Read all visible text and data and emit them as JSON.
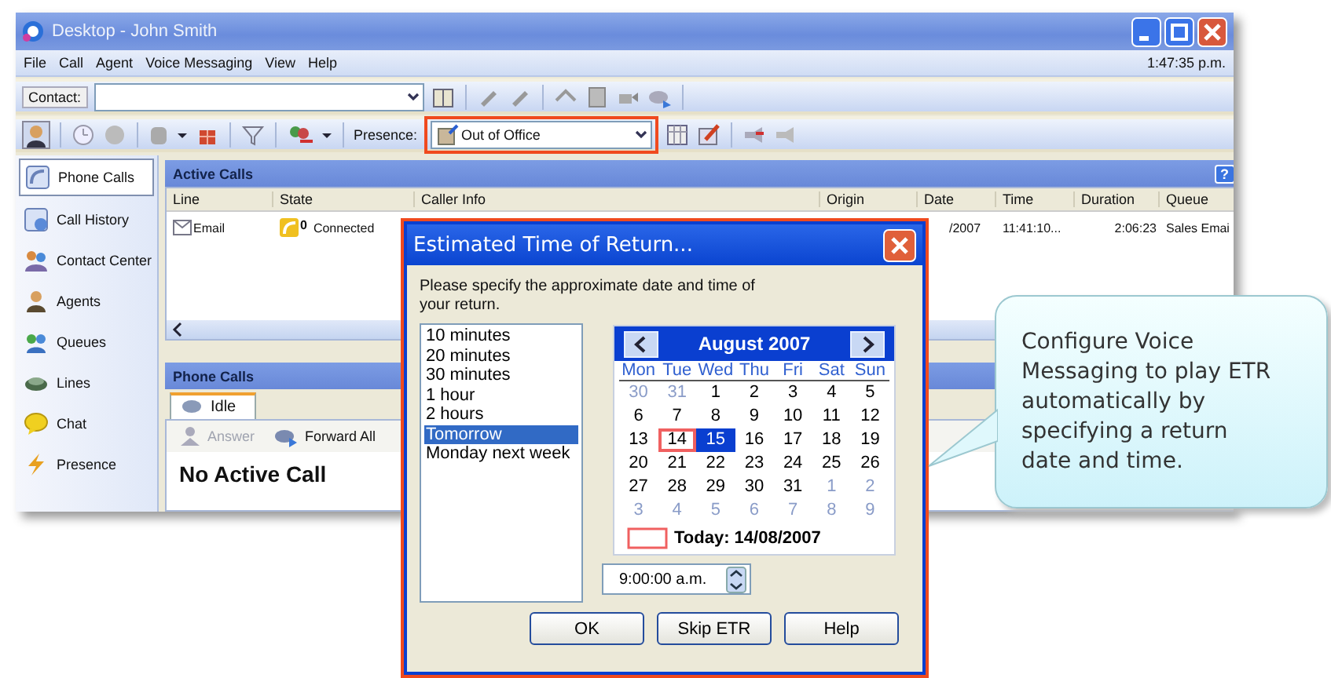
{
  "window": {
    "title": "Desktop - John Smith"
  },
  "menu": [
    {
      "label": "File"
    },
    {
      "label": "Call"
    },
    {
      "label": "Agent"
    },
    {
      "label": "Voice Messaging"
    },
    {
      "label": "View"
    },
    {
      "label": "Help"
    }
  ],
  "clock": "1:47:35 p.m.",
  "contact": {
    "label": "Contact:"
  },
  "presence": {
    "label": "Presence:",
    "value": "Out of Office"
  },
  "sidebar": {
    "items": [
      {
        "label": "Phone Calls",
        "selected": true
      },
      {
        "label": "Call History",
        "selected": false
      },
      {
        "label": "Contact Center",
        "selected": false
      },
      {
        "label": "Agents",
        "selected": false
      },
      {
        "label": "Queues",
        "selected": false
      },
      {
        "label": "Lines",
        "selected": false
      },
      {
        "label": "Chat",
        "selected": false
      },
      {
        "label": "Presence",
        "selected": false
      }
    ]
  },
  "active_calls": {
    "title": "Active Calls",
    "help": "?",
    "columns": [
      "Line",
      "State",
      "Caller Info",
      "Origin",
      "Date",
      "Time",
      "Duration",
      "Queue"
    ],
    "rows": [
      {
        "line": "Email",
        "state_count": "0",
        "state": "Connected",
        "date": "/2007",
        "time": "11:41:10...",
        "duration": "2:06:23",
        "queue": "Sales Emai"
      }
    ]
  },
  "phone_calls": {
    "title": "Phone Calls",
    "tab": "Idle",
    "actions": [
      {
        "label": "Answer",
        "disabled": true
      },
      {
        "label": "Forward All",
        "disabled": false
      }
    ],
    "status": "No Active Call"
  },
  "dialog": {
    "title": "Estimated Time of Return...",
    "prompt": "Please specify the approximate date and time of your return.",
    "options": [
      {
        "label": "10 minutes",
        "selected": false
      },
      {
        "label": "20 minutes",
        "selected": false
      },
      {
        "label": "30 minutes",
        "selected": false
      },
      {
        "label": "1 hour",
        "selected": false
      },
      {
        "label": "2 hours",
        "selected": false
      },
      {
        "label": "Tomorrow",
        "selected": true
      },
      {
        "label": "Monday next week",
        "selected": false
      }
    ],
    "calendar": {
      "month": "August 2007",
      "weekdays": [
        "Mon",
        "Tue",
        "Wed",
        "Thu",
        "Fri",
        "Sat",
        "Sun"
      ],
      "days": [
        {
          "text": "30",
          "in_month": false,
          "today": false,
          "selected": false
        },
        {
          "text": "31",
          "in_month": false,
          "today": false,
          "selected": false
        },
        {
          "text": "1",
          "in_month": true,
          "today": false,
          "selected": false
        },
        {
          "text": "2",
          "in_month": true,
          "today": false,
          "selected": false
        },
        {
          "text": "3",
          "in_month": true,
          "today": false,
          "selected": false
        },
        {
          "text": "4",
          "in_month": true,
          "today": false,
          "selected": false
        },
        {
          "text": "5",
          "in_month": true,
          "today": false,
          "selected": false
        },
        {
          "text": "6",
          "in_month": true,
          "today": false,
          "selected": false
        },
        {
          "text": "7",
          "in_month": true,
          "today": false,
          "selected": false
        },
        {
          "text": "8",
          "in_month": true,
          "today": false,
          "selected": false
        },
        {
          "text": "9",
          "in_month": true,
          "today": false,
          "selected": false
        },
        {
          "text": "10",
          "in_month": true,
          "today": false,
          "selected": false
        },
        {
          "text": "11",
          "in_month": true,
          "today": false,
          "selected": false
        },
        {
          "text": "12",
          "in_month": true,
          "today": false,
          "selected": false
        },
        {
          "text": "13",
          "in_month": true,
          "today": false,
          "selected": false
        },
        {
          "text": "14",
          "in_month": true,
          "today": true,
          "selected": false
        },
        {
          "text": "15",
          "in_month": true,
          "today": false,
          "selected": true
        },
        {
          "text": "16",
          "in_month": true,
          "today": false,
          "selected": false
        },
        {
          "text": "17",
          "in_month": true,
          "today": false,
          "selected": false
        },
        {
          "text": "18",
          "in_month": true,
          "today": false,
          "selected": false
        },
        {
          "text": "19",
          "in_month": true,
          "today": false,
          "selected": false
        },
        {
          "text": "20",
          "in_month": true,
          "today": false,
          "selected": false
        },
        {
          "text": "21",
          "in_month": true,
          "today": false,
          "selected": false
        },
        {
          "text": "22",
          "in_month": true,
          "today": false,
          "selected": false
        },
        {
          "text": "23",
          "in_month": true,
          "today": false,
          "selected": false
        },
        {
          "text": "24",
          "in_month": true,
          "today": false,
          "selected": false
        },
        {
          "text": "25",
          "in_month": true,
          "today": false,
          "selected": false
        },
        {
          "text": "26",
          "in_month": true,
          "today": false,
          "selected": false
        },
        {
          "text": "27",
          "in_month": true,
          "today": false,
          "selected": false
        },
        {
          "text": "28",
          "in_month": true,
          "today": false,
          "selected": false
        },
        {
          "text": "29",
          "in_month": true,
          "today": false,
          "selected": false
        },
        {
          "text": "30",
          "in_month": true,
          "today": false,
          "selected": false
        },
        {
          "text": "31",
          "in_month": true,
          "today": false,
          "selected": false
        },
        {
          "text": "1",
          "in_month": false,
          "today": false,
          "selected": false
        },
        {
          "text": "2",
          "in_month": false,
          "today": false,
          "selected": false
        },
        {
          "text": "3",
          "in_month": false,
          "today": false,
          "selected": false
        },
        {
          "text": "4",
          "in_month": false,
          "today": false,
          "selected": false
        },
        {
          "text": "5",
          "in_month": false,
          "today": false,
          "selected": false
        },
        {
          "text": "6",
          "in_month": false,
          "today": false,
          "selected": false
        },
        {
          "text": "7",
          "in_month": false,
          "today": false,
          "selected": false
        },
        {
          "text": "8",
          "in_month": false,
          "today": false,
          "selected": false
        },
        {
          "text": "9",
          "in_month": false,
          "today": false,
          "selected": false
        }
      ],
      "today_label": "Today: 14/08/2007"
    },
    "time": "9:00:00 a.m.",
    "buttons": [
      "OK",
      "Skip ETR",
      "Help"
    ]
  },
  "callout": "Configure Voice Messaging to play ETR automatically by specifying a return date and time."
}
